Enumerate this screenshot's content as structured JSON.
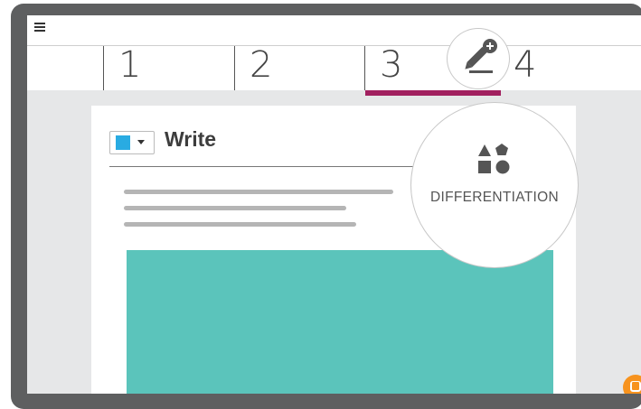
{
  "tabs": [
    {
      "label": "1",
      "active": false
    },
    {
      "label": "2",
      "active": false
    },
    {
      "label": "3",
      "active": true
    },
    {
      "label": "4",
      "active": false
    }
  ],
  "page": {
    "title": "Write",
    "color_swatch": "#29abe2"
  },
  "differentiation": {
    "label": "DIFFERENTIATION",
    "icon": "shapes-icon"
  },
  "edit_button": {
    "icon": "pencil-add-icon"
  },
  "chat_button": {
    "icon": "chat-bubble-icon"
  },
  "colors": {
    "accent": "#a1205f",
    "media": "#5bc4bb",
    "chat": "#f7931e"
  }
}
